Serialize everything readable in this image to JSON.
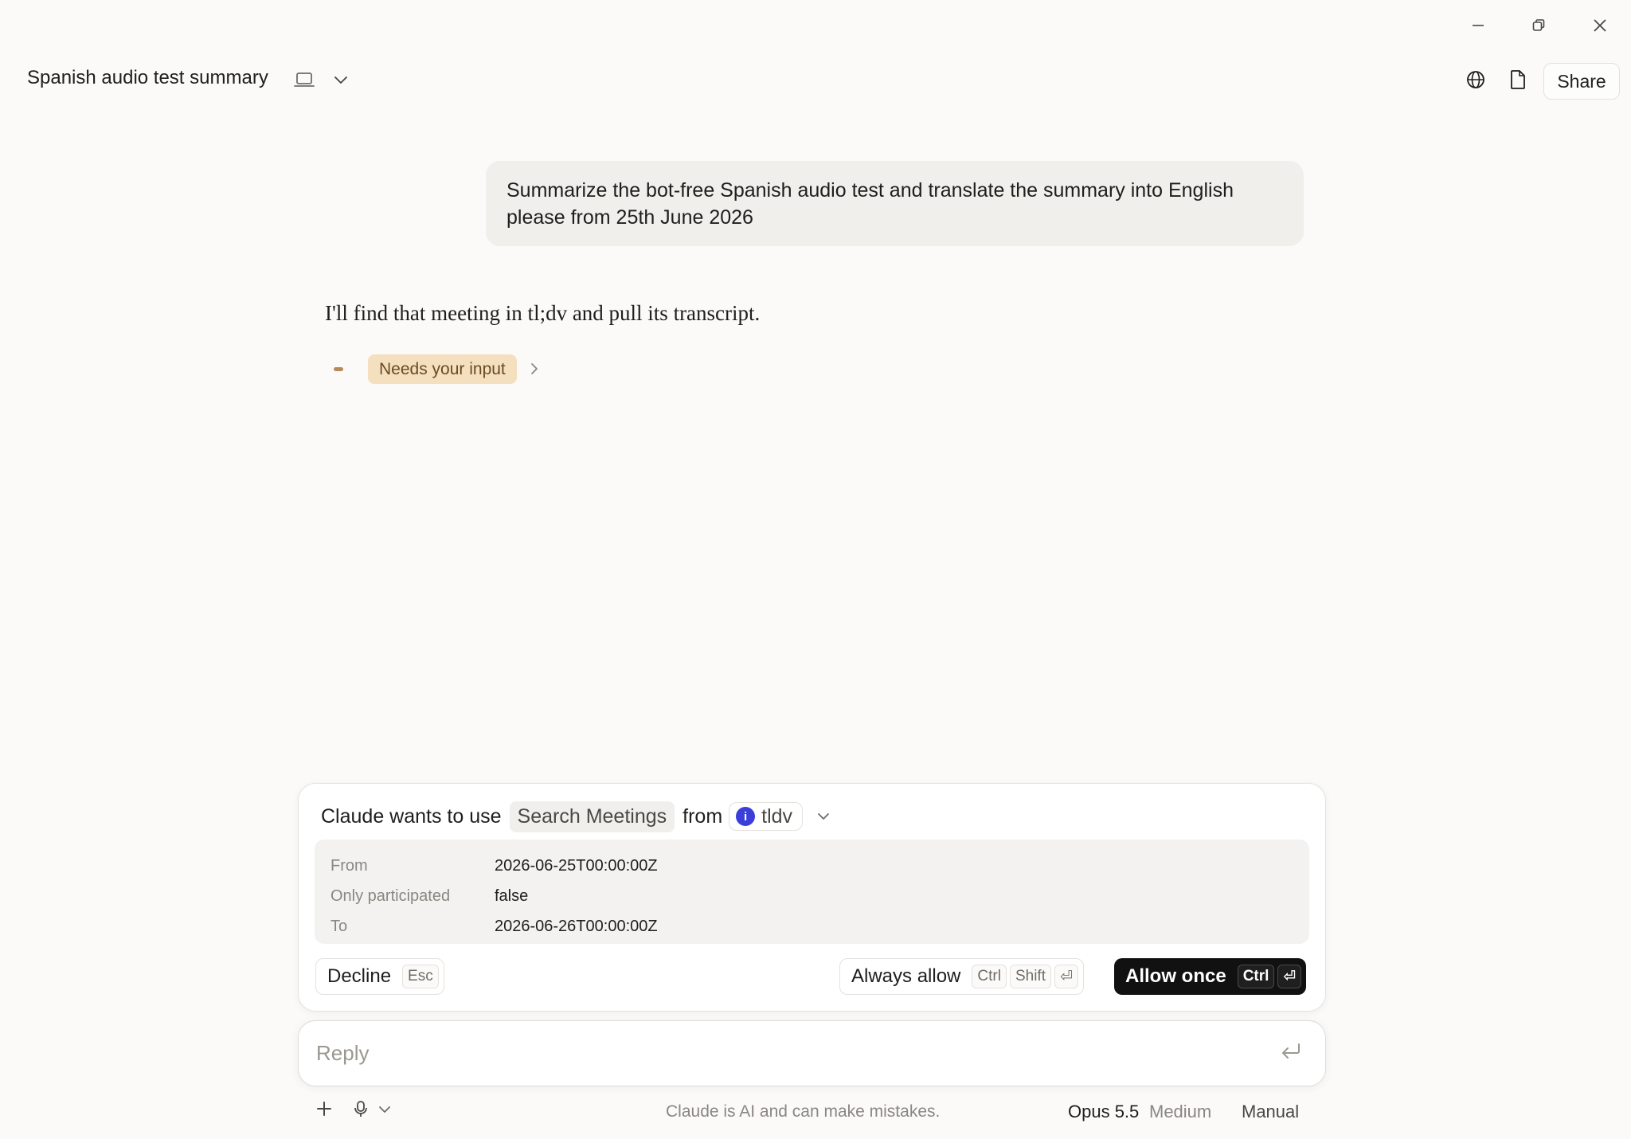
{
  "window": {
    "controls": [
      "minimize-icon",
      "restore-icon",
      "close-icon"
    ]
  },
  "header": {
    "title": "Spanish audio test summary",
    "icons": [
      "laptop-icon",
      "chevron-down-icon",
      "globe-icon",
      "document-icon"
    ],
    "share_label": "Share"
  },
  "conversation": {
    "user_message": "Summarize the bot-free Spanish audio test and translate the summary into English please from 25th June 2026",
    "assistant_message": "I'll find that meeting in tl;dv and pull its transcript.",
    "status_badge": "Needs your input"
  },
  "permission": {
    "prefix": "Claude wants to use",
    "tool_name": "Search Meetings",
    "from_word": "from",
    "server_name": "tldv",
    "server_logo_glyph": "i",
    "server_color": "#3a3fd9",
    "params": [
      {
        "key": "From",
        "value": "2026-06-25T00:00:00Z"
      },
      {
        "key": "Only participated",
        "value": "false"
      },
      {
        "key": "To",
        "value": "2026-06-26T00:00:00Z"
      }
    ],
    "decline": {
      "label": "Decline",
      "shortcut": "Esc"
    },
    "always_allow": {
      "label": "Always allow",
      "shortcuts": [
        "Ctrl",
        "Shift",
        "⏎"
      ]
    },
    "allow_once": {
      "label": "Allow once",
      "shortcuts": [
        "Ctrl",
        "⏎"
      ]
    }
  },
  "composer": {
    "placeholder": "Reply",
    "icons": [
      "send-return-icon",
      "plus-icon",
      "microphone-icon",
      "chevron-down-icon"
    ]
  },
  "footer": {
    "disclaimer": "Claude is AI and can make mistakes.",
    "model": "Opus 5.5",
    "effort": "Medium",
    "mode": "Manual"
  },
  "colors": {
    "background": "#fbfaf9",
    "badge_bg": "#f4dfbf",
    "primary_button": "#111111"
  }
}
